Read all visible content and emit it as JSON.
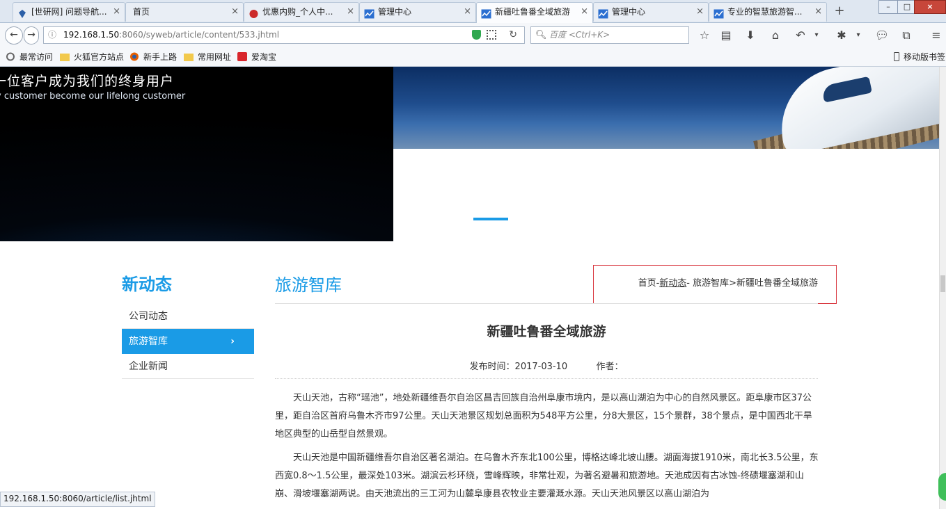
{
  "browser": {
    "tabs": [
      {
        "label": "[世研网] 问题导航...",
        "icon_color": "#2b5fa7",
        "active": false
      },
      {
        "label": "首页",
        "icon_color": "",
        "active": false
      },
      {
        "label": "优惠内购_个人中...",
        "icon_color": "#cc2a2a",
        "active": false
      },
      {
        "label": "管理中心",
        "icon_color": "#2b6fd1",
        "active": false
      },
      {
        "label": "新疆吐鲁番全域旅游",
        "icon_color": "#2b6fd1",
        "active": true
      },
      {
        "label": "管理中心",
        "icon_color": "#2b6fd1",
        "active": false
      },
      {
        "label": "专业的智慧旅游智...",
        "icon_color": "#2b6fd1",
        "active": false
      }
    ],
    "new_tab": "+",
    "url_host": "192.168.1.50",
    "url_rest": ":8060/syweb/article/content/533.jhtml",
    "search_placeholder": "百度 <Ctrl+K>",
    "bookmarks": [
      "最常访问",
      "火狐官方站点",
      "新手上路",
      "常用网址",
      "爱淘宝"
    ],
    "mobile_bookmarks": "移动版书签",
    "status_url": "192.168.1.50:8060/article/list.jhtml"
  },
  "hero": {
    "slogan_cn": "一位客户成为我们的终身用户",
    "slogan_en": "y customer become our lifelong customer"
  },
  "sidebar": {
    "title": "新动态",
    "items": [
      {
        "label": "公司动态"
      },
      {
        "label": "旅游智库",
        "chevron": "›"
      },
      {
        "label": "企业新闻"
      }
    ]
  },
  "section": {
    "title": "旅游智库",
    "breadcrumb": {
      "home": "首页-",
      "link": "新动态",
      "rest": "- 旅游智库>新疆吐鲁番全域旅游"
    }
  },
  "article": {
    "title": "新疆吐鲁番全域旅游",
    "meta_date": "发布时间：2017-03-10",
    "meta_author": "作者：",
    "paragraphs": [
      "天山天池，古称“瑶池”，地处新疆维吾尔自治区昌吉回族自治州阜康市境内，是以高山湖泊为中心的自然风景区。距阜康市区37公里，距自治区首府乌鲁木齐市97公里。天山天池景区规划总面积为548平方公里，分8大景区，15个景群，38个景点，是中国西北干旱地区典型的山岳型自然景观。",
      "天山天池是中国新疆维吾尔自治区著名湖泊。在乌鲁木齐东北100公里，博格达峰北坡山腰。湖面海拔1910米，南北长3.5公里，东西宽0.8～1.5公里，最深处103米。湖滨云杉环绕，雪峰辉映，非常壮观，为著名避暑和旅游地。天池成因有古冰蚀-终碛堰塞湖和山崩、滑坡堰塞湖两说。由天池流出的三工河为山麓阜康县农牧业主要灌溉水源。天山天池风景区以高山湖泊为"
    ]
  },
  "colors": {
    "accent": "#1a9be6",
    "breadcrumb_border": "#d9363e"
  }
}
